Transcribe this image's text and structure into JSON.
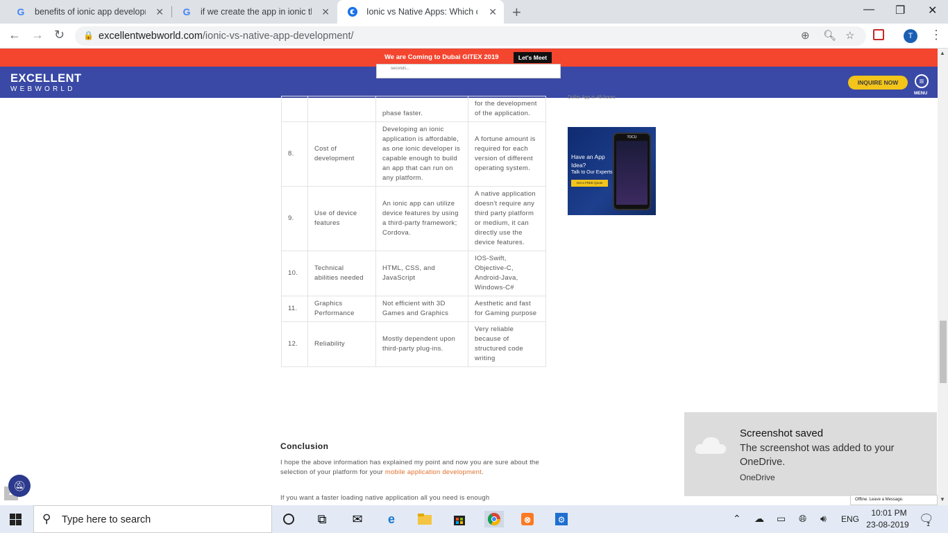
{
  "browser": {
    "tabs": [
      {
        "title": "benefits of ionic app developmen",
        "icon": "google-icon",
        "active": false
      },
      {
        "title": "if we create the app in ionic then",
        "icon": "google-icon",
        "active": false
      },
      {
        "title": "Ionic vs Native Apps: Which one",
        "icon": "site-favicon",
        "active": true
      }
    ],
    "url_domain": "excellentwebworld.com",
    "url_path": "/ionic-vs-native-app-development/",
    "profile_initial": "T"
  },
  "site": {
    "promo_text": "We are Coming to Dubai GITEX 2019",
    "promo_button": "Let's Meet",
    "logo_line1": "EXCELLENT",
    "logo_line2": "WEBWORLD",
    "inquire_button": "INQUIRE NOW",
    "menu_label": "MENU",
    "popup_text": "seconds..."
  },
  "table": {
    "partial_row": {
      "ionic": "phase faster.",
      "native": "for the development of the application."
    },
    "rows": [
      {
        "num": "8.",
        "category": "Cost of development",
        "ionic": "Developing an ionic application is affordable, as one ionic developer is capable enough to build an app that can run on any platform.",
        "native": "A fortune amount is required for each version of different operating system."
      },
      {
        "num": "9.",
        "category": "Use of device features",
        "ionic": "An ionic app can utilize device features by using a third-party framework; Cordova.",
        "native": "A native application doesn't require any third party platform or medium, it can directly use the device features."
      },
      {
        "num": "10.",
        "category": "Technical abilities needed",
        "ionic": "HTML, CSS, and JavaScript",
        "native": "IOS-Swift, Objective-C, Android-Java, Windows-C#"
      },
      {
        "num": "11.",
        "category": "Graphics Performance",
        "ionic": "Not efficient with 3D Games and Graphics",
        "native": "Aesthetic and fast for Gaming purpose"
      },
      {
        "num": "12.",
        "category": "Reliability",
        "ionic": "Mostly dependent upon third-party plug-ins.",
        "native": "Very reliable because of structured code writing"
      }
    ]
  },
  "article": {
    "conclusion_heading": "Conclusion",
    "para1_before": "I hope the above information has explained my point and now you are sure about the selection of your platform for your ",
    "para1_link": "mobile application development",
    "para1_after": ".",
    "para2": "If you want a faster loading native application all you need is enough"
  },
  "sidebar": {
    "partial_text": "Dollar App in 48 hours",
    "ad_line1": "Have an App Idea?",
    "ad_line2": "Talk to Our Experts",
    "ad_button": "Get a FREE Quote",
    "ad_phone_brand": "TOCU"
  },
  "toast": {
    "title": "Screenshot saved",
    "body": "The screenshot was added to your OneDrive.",
    "source": "OneDrive"
  },
  "chat_bar": "Offline. Leave a Message.",
  "taskbar": {
    "search_placeholder": "Type here to search",
    "language": "ENG",
    "time": "10:01 PM",
    "date": "23-08-2019",
    "notification_count": "1"
  }
}
